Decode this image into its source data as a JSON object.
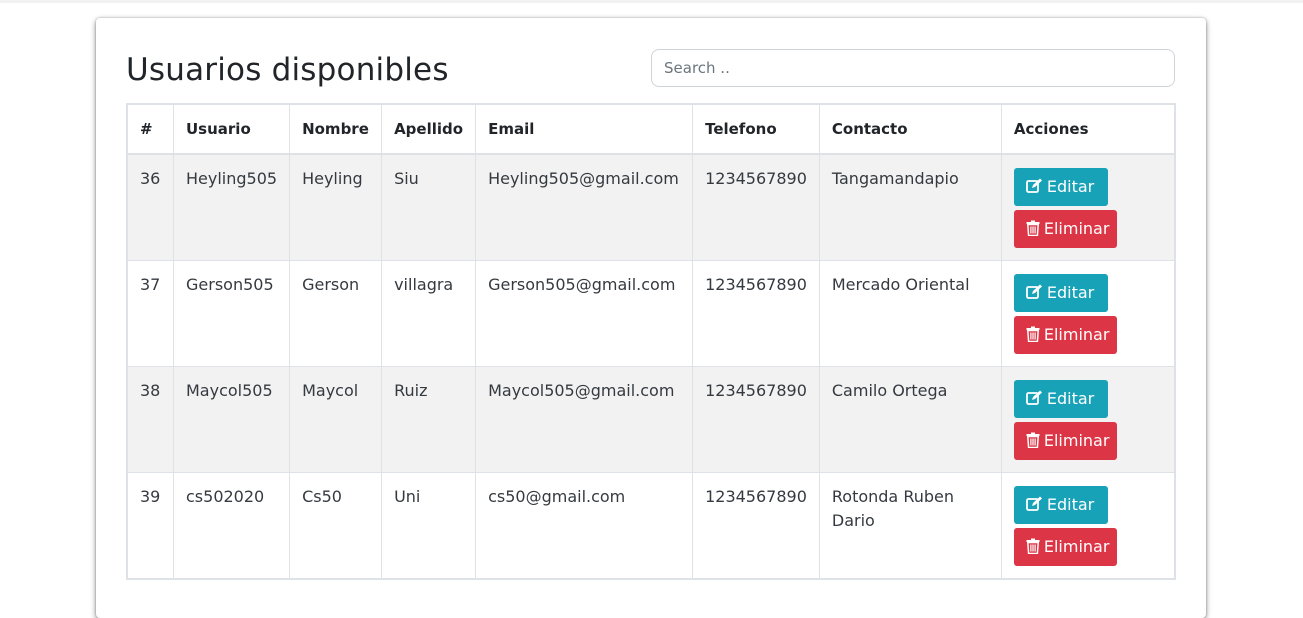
{
  "page": {
    "title": "Usuarios disponibles"
  },
  "search": {
    "placeholder": "Search .."
  },
  "table": {
    "headers": [
      "#",
      "Usuario",
      "Nombre",
      "Apellido",
      "Email",
      "Telefono",
      "Contacto",
      "Acciones"
    ],
    "rows": [
      {
        "id": "36",
        "usuario": "Heyling505",
        "nombre": "Heyling",
        "apellido": "Siu",
        "email": "Heyling505@gmail.com",
        "telefono": "1234567890",
        "contacto": "Tangamandapio"
      },
      {
        "id": "37",
        "usuario": "Gerson505",
        "nombre": "Gerson",
        "apellido": "villagra",
        "email": "Gerson505@gmail.com",
        "telefono": "1234567890",
        "contacto": "Mercado Oriental"
      },
      {
        "id": "38",
        "usuario": "Maycol505",
        "nombre": "Maycol",
        "apellido": "Ruiz",
        "email": "Maycol505@gmail.com",
        "telefono": "1234567890",
        "contacto": "Camilo Ortega"
      },
      {
        "id": "39",
        "usuario": "cs502020",
        "nombre": "Cs50",
        "apellido": "Uni",
        "email": "cs50@gmail.com",
        "telefono": "1234567890",
        "contacto": "Rotonda Ruben Dario"
      }
    ]
  },
  "actions": {
    "edit_label": "Editar",
    "delete_label": "Eliminar",
    "edit_icon": "edit-icon",
    "delete_icon": "trash-icon"
  },
  "colors": {
    "edit": "#17a2b8",
    "delete": "#dc3545",
    "stripe": "#f2f2f2"
  }
}
